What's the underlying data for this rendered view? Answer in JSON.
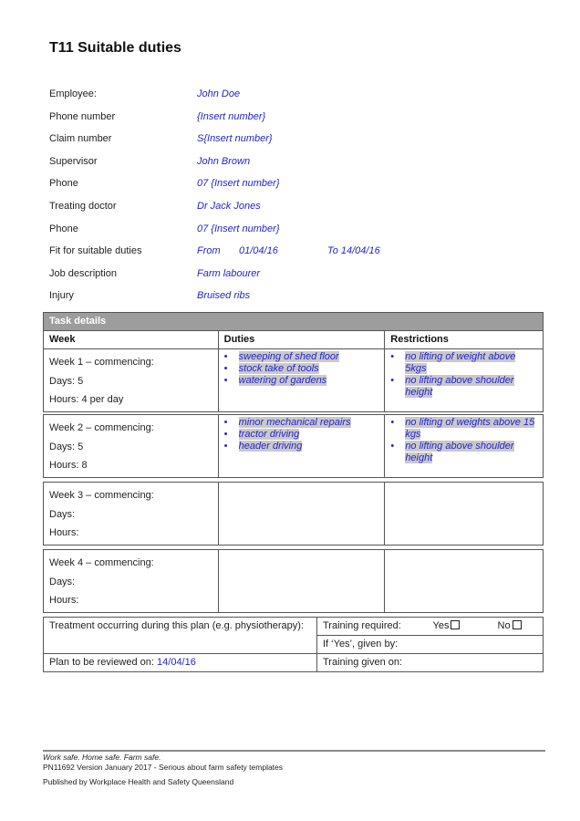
{
  "title": "T11 Suitable duties",
  "info": {
    "employee": {
      "label": "Employee:",
      "value": "John Doe"
    },
    "phone_number": {
      "label": "Phone number",
      "value": "{Insert number}"
    },
    "claim_number": {
      "label": "Claim number",
      "value": "S{Insert number}"
    },
    "supervisor": {
      "label": "Supervisor",
      "value": "John Brown"
    },
    "supervisor_phone": {
      "label": "Phone",
      "value": "07 {Insert number}"
    },
    "treating_doctor": {
      "label": "Treating doctor",
      "value": "Dr Jack Jones"
    },
    "doctor_phone": {
      "label": "Phone",
      "value": "07 {Insert number}"
    },
    "fit_for_duties": {
      "label": "Fit for suitable duties",
      "from_label": "From",
      "from_date": "01/04/16",
      "to": "To 14/04/16"
    },
    "job_description": {
      "label": "Job description",
      "value": "Farm labourer"
    },
    "injury": {
      "label": "Injury",
      "value": "Bruised ribs"
    }
  },
  "task_details": {
    "heading": "Task details",
    "columns": [
      "Week",
      "Duties",
      "Restrictions"
    ],
    "weeks": [
      {
        "commencing": "Week 1 – commencing:",
        "days": "Days: 5",
        "hours": "Hours: 4 per day",
        "duties": [
          "sweeping of shed floor",
          "stock take of tools",
          "watering of gardens"
        ],
        "restrictions": [
          "no lifting of weight above 5kgs",
          "no lifting above shoulder height"
        ]
      },
      {
        "commencing": "Week 2 – commencing:",
        "days": "Days: 5",
        "hours": "Hours: 8",
        "duties": [
          "minor mechanical repairs",
          "tractor driving",
          "header driving"
        ],
        "restrictions": [
          "no lifting of weights above 15 kgs",
          "no lifting above shoulder height"
        ]
      },
      {
        "commencing": "Week 3 – commencing:",
        "days": "Days:",
        "hours": "Hours:",
        "duties": [],
        "restrictions": []
      },
      {
        "commencing": "Week 4 – commencing:",
        "days": "Days:",
        "hours": "Hours:",
        "duties": [],
        "restrictions": []
      }
    ]
  },
  "bottom": {
    "treatment_label": "Treatment occurring during this plan (e.g. physiotherapy):",
    "review_label": "Plan to be reviewed on: ",
    "review_date": "14/04/16",
    "training_required_label": "Training required:",
    "yes_label": "Yes",
    "no_label": "No",
    "given_by_label": "If ‘Yes’, given by:",
    "training_given_on_label": "Training given on:"
  },
  "footer": {
    "slogan": "Work safe. Home safe. Farm safe.",
    "version": "PN11692 Version January 2017 - Serious about farm safety templates",
    "publisher": "Published by Workplace Health and Safety Queensland"
  }
}
